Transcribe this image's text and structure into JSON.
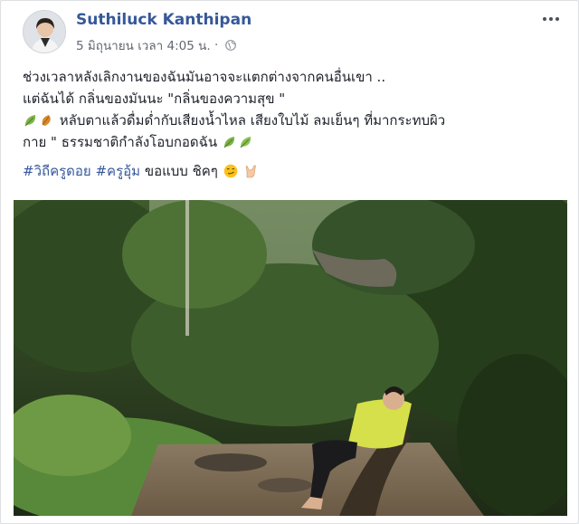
{
  "post": {
    "author": "Suthiluck Kanthipan",
    "date": "5 มิถุนายน เวลา 4:05 น.",
    "separator": "·",
    "line1": "ช่วงเวลาหลังเลิกงานของฉันมันอาจจะแตกต่างจากคนอื่นเขา ..",
    "line2": "แต่ฉันได้ กลิ่นของมันนะ \"กลิ่นของความสุข \"",
    "line3": "หลับตาแล้วดื่มด่ำกับเสียงน้ำไหล เสียงใบไม้ ลมเย็นๆ ที่มากระทบผิว",
    "line4": "กาย \" ธรรมชาติกำลังโอบกอดฉัน",
    "hashtag1": "#วิถีครูดอย",
    "hashtag2": "#ครูอุ้ม",
    "tail": "ขอแบบ ชิคๆ"
  },
  "icons": {
    "more": "more-options-icon",
    "audience": "globe-icon",
    "leaf": "leaf-emoji-icon",
    "autumn_leaf": "fallen-leaf-emoji-icon",
    "smirk": "smirk-emoji-icon",
    "rock_hand": "rock-on-hand-emoji-icon"
  },
  "colors": {
    "name_link": "#365899",
    "text": "#1d2129",
    "meta": "#616770"
  }
}
